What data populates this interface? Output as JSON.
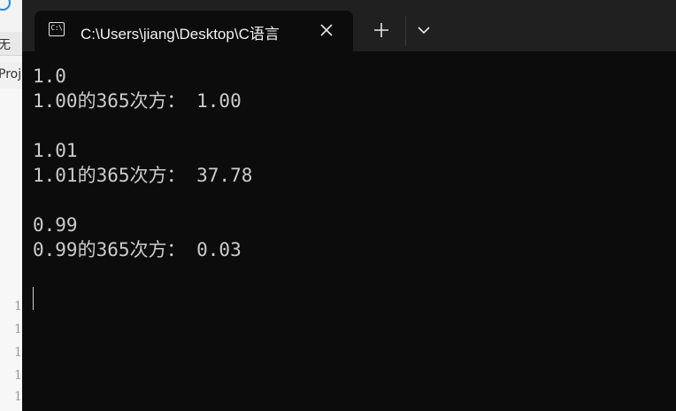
{
  "background_window": {
    "fragment_1": "无",
    "fragment_2": "Proj",
    "line_numbers": [
      "1",
      "1",
      "1",
      "1",
      "1"
    ]
  },
  "terminal": {
    "tab_title": "C:\\Users\\jiang\\Desktop\\C语言",
    "tab_icon": "terminal-icon",
    "close_icon": "close-icon",
    "new_tab_icon": "plus-icon",
    "dropdown_icon": "chevron-down-icon",
    "output_lines": [
      "1.0",
      "1.00的365次方： 1.00",
      "",
      "1.01",
      "1.01的365次方： 37.78",
      "",
      "0.99",
      "0.99的365次方： 0.03"
    ]
  },
  "colors": {
    "terminal_bg": "#0c0c0c",
    "tabbar_bg": "#202020",
    "text": "#cccccc"
  }
}
